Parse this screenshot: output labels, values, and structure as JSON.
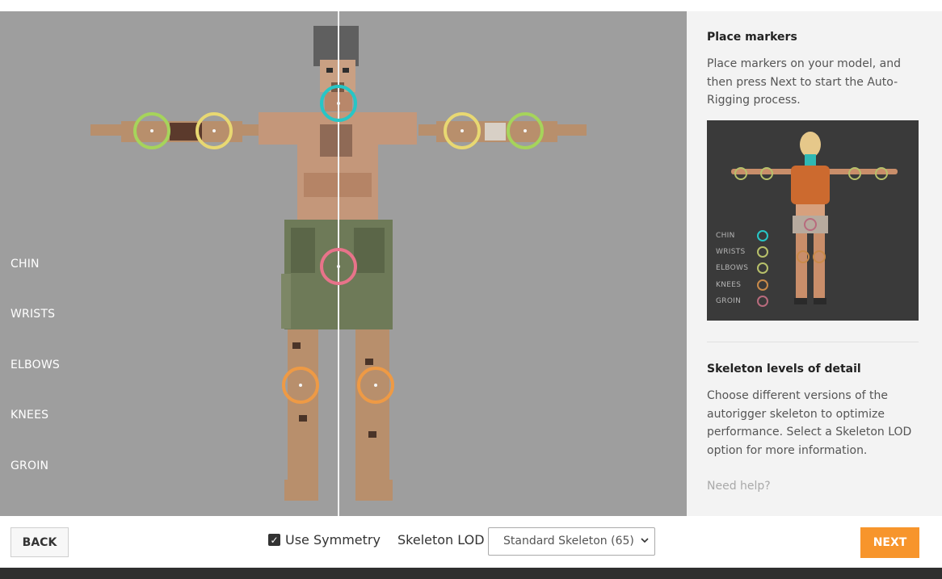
{
  "viewport": {
    "marker_labels": [
      "CHIN",
      "WRISTS",
      "ELBOWS",
      "KNEES",
      "GROIN"
    ]
  },
  "sidebar": {
    "place_title": "Place markers",
    "place_text": "Place markers on your model, and then press Next to start the Auto-Rigging process.",
    "diagram_legend": [
      {
        "label": "CHIN",
        "color": "#27c6c6"
      },
      {
        "label": "WRISTS",
        "color": "#b7c06a"
      },
      {
        "label": "ELBOWS",
        "color": "#b7c06a"
      },
      {
        "label": "KNEES",
        "color": "#c88a4a"
      },
      {
        "label": "GROIN",
        "color": "#b86b7d"
      }
    ],
    "lod_title": "Skeleton levels of detail",
    "lod_text": "Choose different versions of the autorigger skeleton to optimize performance. Select a Skeleton LOD option for more information.",
    "help_link": "Need help?"
  },
  "footer": {
    "back_label": "BACK",
    "use_symmetry_label": "Use Symmetry",
    "use_symmetry_checked": true,
    "skeleton_lod_label": "Skeleton LOD",
    "skeleton_lod_value": "Standard Skeleton (65)",
    "next_label": "NEXT"
  },
  "colors": {
    "accent": "#f7952c",
    "chin_marker": "#27c6c6",
    "wrist_marker": "#a6d45b",
    "elbow_marker": "#e8d872",
    "groin_marker": "#e8738a",
    "knee_marker": "#ee9a45"
  }
}
